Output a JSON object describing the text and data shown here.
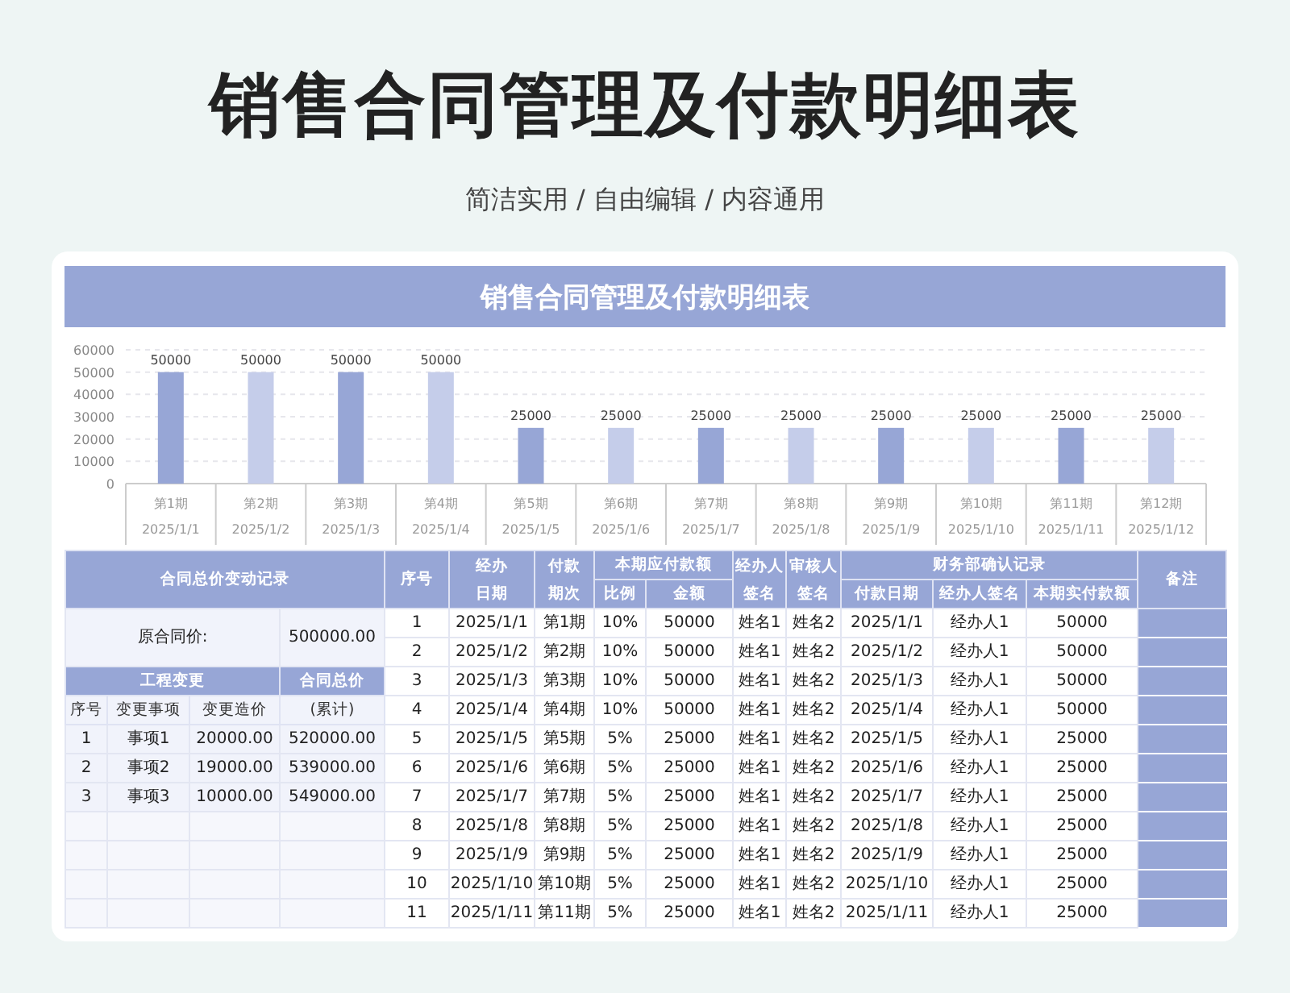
{
  "title": "销售合同管理及付款明细表",
  "subtitle": "简洁实用 / 自由编辑 / 内容通用",
  "sheet_title": "销售合同管理及付款明细表",
  "chart": {
    "axis_dates": [
      "2025/1/1",
      "2025/1/2",
      "2025/1/3",
      "2025/1/4",
      "2025/1/5",
      "2025/1/6",
      "2025/1/7",
      "2025/1/8",
      "2025/1/9",
      "2025/1/10",
      "2025/1/11",
      "2025/1/12"
    ],
    "chart_data": {
      "type": "bar",
      "categories": [
        "第1期",
        "第2期",
        "第3期",
        "第4期",
        "第5期",
        "第6期",
        "第7期",
        "第8期",
        "第9期",
        "第10期",
        "第11期",
        "第12期"
      ],
      "series": [
        {
          "color": "#97a6d6",
          "values": [
            50000,
            null,
            50000,
            null,
            25000,
            null,
            25000,
            null,
            25000,
            null,
            25000,
            null
          ]
        },
        {
          "color": "#c5cdea",
          "values": [
            null,
            50000,
            null,
            50000,
            null,
            25000,
            null,
            25000,
            null,
            25000,
            null,
            25000
          ]
        }
      ],
      "grid": true,
      "ylim": [
        0,
        60000
      ],
      "yticks": [
        0,
        10000,
        20000,
        30000,
        40000,
        50000,
        60000
      ],
      "data_labels": true
    }
  },
  "left": {
    "header": "合同总价变动记录",
    "base_label": "原合同价:",
    "base_value": "500000.00",
    "change_header": "工程变更",
    "total_header": "合同总价",
    "change_columns": [
      "序号",
      "变更事项",
      "变更造价",
      "(累计)"
    ],
    "changes": [
      {
        "cells": [
          "1",
          "事项1",
          "20000.00",
          "520000.00"
        ]
      },
      {
        "cells": [
          "2",
          "事项2",
          "19000.00",
          "539000.00"
        ]
      },
      {
        "cells": [
          "3",
          "事项3",
          "10000.00",
          "549000.00"
        ]
      }
    ]
  },
  "payments": {
    "header_seq": "序号",
    "header_date": "经办日期",
    "header_period": "付款期次",
    "header_due": "本期应付款额",
    "header_ratio": "比例",
    "header_amount": "金额",
    "header_handler": "经办人签名",
    "header_reviewer": "审核人签名",
    "header_finance": "财务部确认记录",
    "header_pay_date": "付款日期",
    "header_fin_handler": "经办人签名",
    "header_paid": "本期实付款额",
    "header_remark": "备注",
    "rows": [
      {
        "cells": [
          "1",
          "2025/1/1",
          "第1期",
          "10%",
          "50000",
          "姓名1",
          "姓名2",
          "2025/1/1",
          "经办人1",
          "50000"
        ]
      },
      {
        "cells": [
          "2",
          "2025/1/2",
          "第2期",
          "10%",
          "50000",
          "姓名1",
          "姓名2",
          "2025/1/2",
          "经办人1",
          "50000"
        ]
      },
      {
        "cells": [
          "3",
          "2025/1/3",
          "第3期",
          "10%",
          "50000",
          "姓名1",
          "姓名2",
          "2025/1/3",
          "经办人1",
          "50000"
        ]
      },
      {
        "cells": [
          "4",
          "2025/1/4",
          "第4期",
          "10%",
          "50000",
          "姓名1",
          "姓名2",
          "2025/1/4",
          "经办人1",
          "50000"
        ]
      },
      {
        "cells": [
          "5",
          "2025/1/5",
          "第5期",
          "5%",
          "25000",
          "姓名1",
          "姓名2",
          "2025/1/5",
          "经办人1",
          "25000"
        ]
      },
      {
        "cells": [
          "6",
          "2025/1/6",
          "第6期",
          "5%",
          "25000",
          "姓名1",
          "姓名2",
          "2025/1/6",
          "经办人1",
          "25000"
        ]
      },
      {
        "cells": [
          "7",
          "2025/1/7",
          "第7期",
          "5%",
          "25000",
          "姓名1",
          "姓名2",
          "2025/1/7",
          "经办人1",
          "25000"
        ]
      },
      {
        "cells": [
          "8",
          "2025/1/8",
          "第8期",
          "5%",
          "25000",
          "姓名1",
          "姓名2",
          "2025/1/8",
          "经办人1",
          "25000"
        ]
      },
      {
        "cells": [
          "9",
          "2025/1/9",
          "第9期",
          "5%",
          "25000",
          "姓名1",
          "姓名2",
          "2025/1/9",
          "经办人1",
          "25000"
        ]
      },
      {
        "cells": [
          "10",
          "2025/1/10",
          "第10期",
          "5%",
          "25000",
          "姓名1",
          "姓名2",
          "2025/1/10",
          "经办人1",
          "25000"
        ]
      },
      {
        "cells": [
          "11",
          "2025/1/11",
          "第11期",
          "5%",
          "25000",
          "姓名1",
          "姓名2",
          "2025/1/11",
          "经办人1",
          "25000"
        ]
      }
    ]
  }
}
